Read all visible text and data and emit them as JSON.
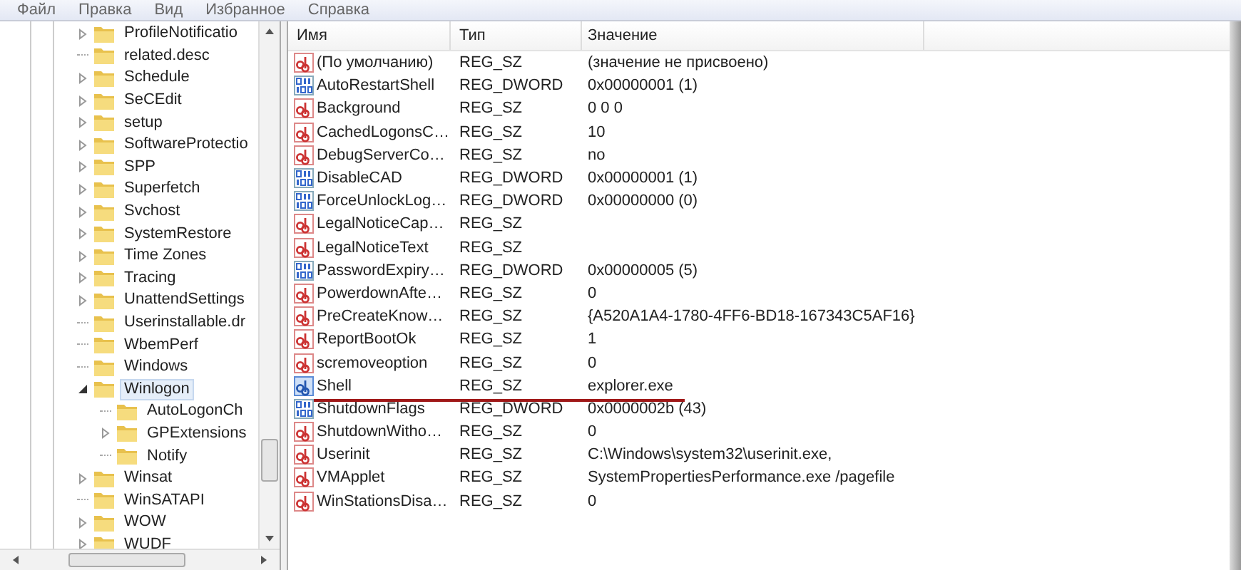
{
  "menu": [
    "Файл",
    "Правка",
    "Вид",
    "Избранное",
    "Справка"
  ],
  "tree": [
    {
      "label": "ProfileNotificatio",
      "kind": "folder",
      "expanded": false,
      "selected": false
    },
    {
      "label": "related.desc",
      "kind": "leaf",
      "selected": false
    },
    {
      "label": "Schedule",
      "kind": "folder",
      "expanded": false,
      "selected": false
    },
    {
      "label": "SeCEdit",
      "kind": "folder",
      "expanded": false,
      "selected": false
    },
    {
      "label": "setup",
      "kind": "folder",
      "expanded": false,
      "selected": false
    },
    {
      "label": "SoftwareProtectio",
      "kind": "folder",
      "expanded": false,
      "selected": false
    },
    {
      "label": "SPP",
      "kind": "folder",
      "expanded": false,
      "selected": false
    },
    {
      "label": "Superfetch",
      "kind": "folder",
      "expanded": false,
      "selected": false
    },
    {
      "label": "Svchost",
      "kind": "folder",
      "expanded": false,
      "selected": false
    },
    {
      "label": "SystemRestore",
      "kind": "folder",
      "expanded": false,
      "selected": false
    },
    {
      "label": "Time Zones",
      "kind": "folder",
      "expanded": false,
      "selected": false
    },
    {
      "label": "Tracing",
      "kind": "folder",
      "expanded": false,
      "selected": false
    },
    {
      "label": "UnattendSettings",
      "kind": "folder",
      "expanded": false,
      "selected": false
    },
    {
      "label": "Userinstallable.dr",
      "kind": "leaf",
      "selected": false
    },
    {
      "label": "WbemPerf",
      "kind": "leaf",
      "selected": false
    },
    {
      "label": "Windows",
      "kind": "leaf",
      "selected": false
    },
    {
      "label": "Winlogon",
      "kind": "folder",
      "expanded": true,
      "selected": true,
      "children": [
        {
          "label": "AutoLogonCh",
          "kind": "leaf",
          "selected": false
        },
        {
          "label": "GPExtensions",
          "kind": "folder",
          "expanded": false,
          "selected": false
        },
        {
          "label": "Notify",
          "kind": "leaf",
          "selected": false
        }
      ]
    },
    {
      "label": "Winsat",
      "kind": "folder",
      "expanded": false,
      "selected": false
    },
    {
      "label": "WinSATAPI",
      "kind": "leaf",
      "selected": false
    },
    {
      "label": "WOW",
      "kind": "folder",
      "expanded": false,
      "selected": false
    },
    {
      "label": "WUDF",
      "kind": "folder",
      "expanded": false,
      "selected": false
    }
  ],
  "table": {
    "columns": [
      "Имя",
      "Тип",
      "Значение"
    ],
    "rows": [
      {
        "kind": "string",
        "name": "(По умолчанию)",
        "type": "REG_SZ",
        "value": "(значение не присвоено)",
        "selected": false,
        "underlined": false
      },
      {
        "kind": "binary",
        "name": "AutoRestartShell",
        "type": "REG_DWORD",
        "value": "0x00000001 (1)",
        "selected": false,
        "underlined": false
      },
      {
        "kind": "string",
        "name": "Background",
        "type": "REG_SZ",
        "value": "0 0 0",
        "selected": false,
        "underlined": false
      },
      {
        "kind": "string",
        "name": "CachedLogonsC…",
        "type": "REG_SZ",
        "value": "10",
        "selected": false,
        "underlined": false
      },
      {
        "kind": "string",
        "name": "DebugServerCo…",
        "type": "REG_SZ",
        "value": "no",
        "selected": false,
        "underlined": false
      },
      {
        "kind": "binary",
        "name": "DisableCAD",
        "type": "REG_DWORD",
        "value": "0x00000001 (1)",
        "selected": false,
        "underlined": false
      },
      {
        "kind": "binary",
        "name": "ForceUnlockLog…",
        "type": "REG_DWORD",
        "value": "0x00000000 (0)",
        "selected": false,
        "underlined": false
      },
      {
        "kind": "string",
        "name": "LegalNoticeCap…",
        "type": "REG_SZ",
        "selected": false,
        "underlined": false
      },
      {
        "kind": "string",
        "name": "LegalNoticeText",
        "type": "REG_SZ",
        "selected": false,
        "underlined": false
      },
      {
        "kind": "binary",
        "name": "PasswordExpiry…",
        "type": "REG_DWORD",
        "value": "0x00000005 (5)",
        "selected": false,
        "underlined": false
      },
      {
        "kind": "string",
        "name": "PowerdownAfte…",
        "type": "REG_SZ",
        "value": "0",
        "selected": false,
        "underlined": false
      },
      {
        "kind": "string",
        "name": "PreCreateKnow…",
        "type": "REG_SZ",
        "value": "{A520A1A4-1780-4FF6-BD18-167343C5AF16}",
        "selected": false,
        "underlined": false
      },
      {
        "kind": "string",
        "name": "ReportBootOk",
        "type": "REG_SZ",
        "value": "1",
        "selected": false,
        "underlined": false
      },
      {
        "kind": "string",
        "name": "scremoveoption",
        "type": "REG_SZ",
        "value": "0",
        "selected": false,
        "underlined": false
      },
      {
        "kind": "string",
        "name": "Shell",
        "type": "REG_SZ",
        "value": "explorer.exe",
        "selected": true,
        "underlined": true
      },
      {
        "kind": "binary",
        "name": "ShutdownFlags",
        "type": "REG_DWORD",
        "value": "0x0000002b (43)",
        "selected": false,
        "underlined": false
      },
      {
        "kind": "string",
        "name": "ShutdownWitho…",
        "type": "REG_SZ",
        "value": "0",
        "selected": false,
        "underlined": false
      },
      {
        "kind": "string",
        "name": "Userinit",
        "type": "REG_SZ",
        "value": "C:\\Windows\\system32\\userinit.exe,",
        "selected": false,
        "underlined": false
      },
      {
        "kind": "string",
        "name": "VMApplet",
        "type": "REG_SZ",
        "value": "SystemPropertiesPerformance.exe /pagefile",
        "selected": false,
        "underlined": false
      },
      {
        "kind": "string",
        "name": "WinStationsDisa…",
        "type": "REG_SZ",
        "value": "0",
        "selected": false,
        "underlined": false
      }
    ]
  }
}
